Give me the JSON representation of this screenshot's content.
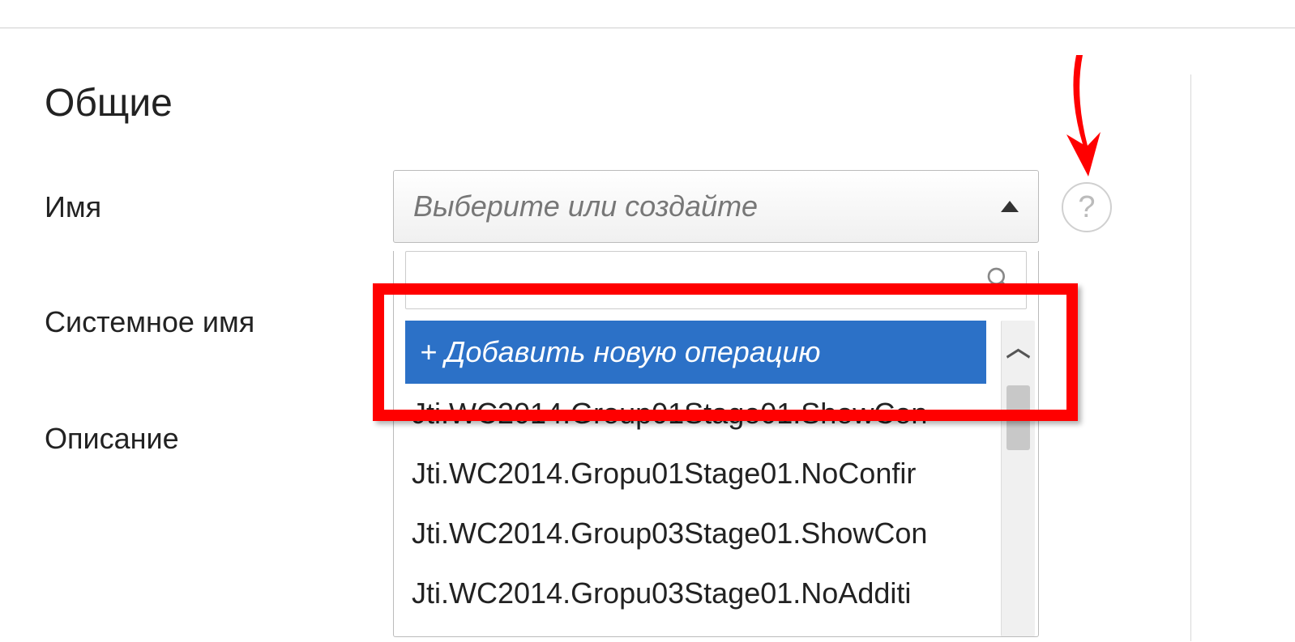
{
  "section": {
    "title": "Общие"
  },
  "labels": {
    "name": "Имя",
    "system_name": "Системное имя",
    "description": "Описание"
  },
  "combo": {
    "placeholder": "Выберите или создайте",
    "add_new": "+ Добавить новую операцию",
    "options": [
      "Jti.WC2014.Group01Stage01.ShowCon",
      "Jti.WC2014.Gropu01Stage01.NoConfir",
      "Jti.WC2014.Group03Stage01.ShowCon",
      "Jti.WC2014.Gropu03Stage01.NoAdditi"
    ]
  },
  "icons": {
    "help": "?"
  }
}
